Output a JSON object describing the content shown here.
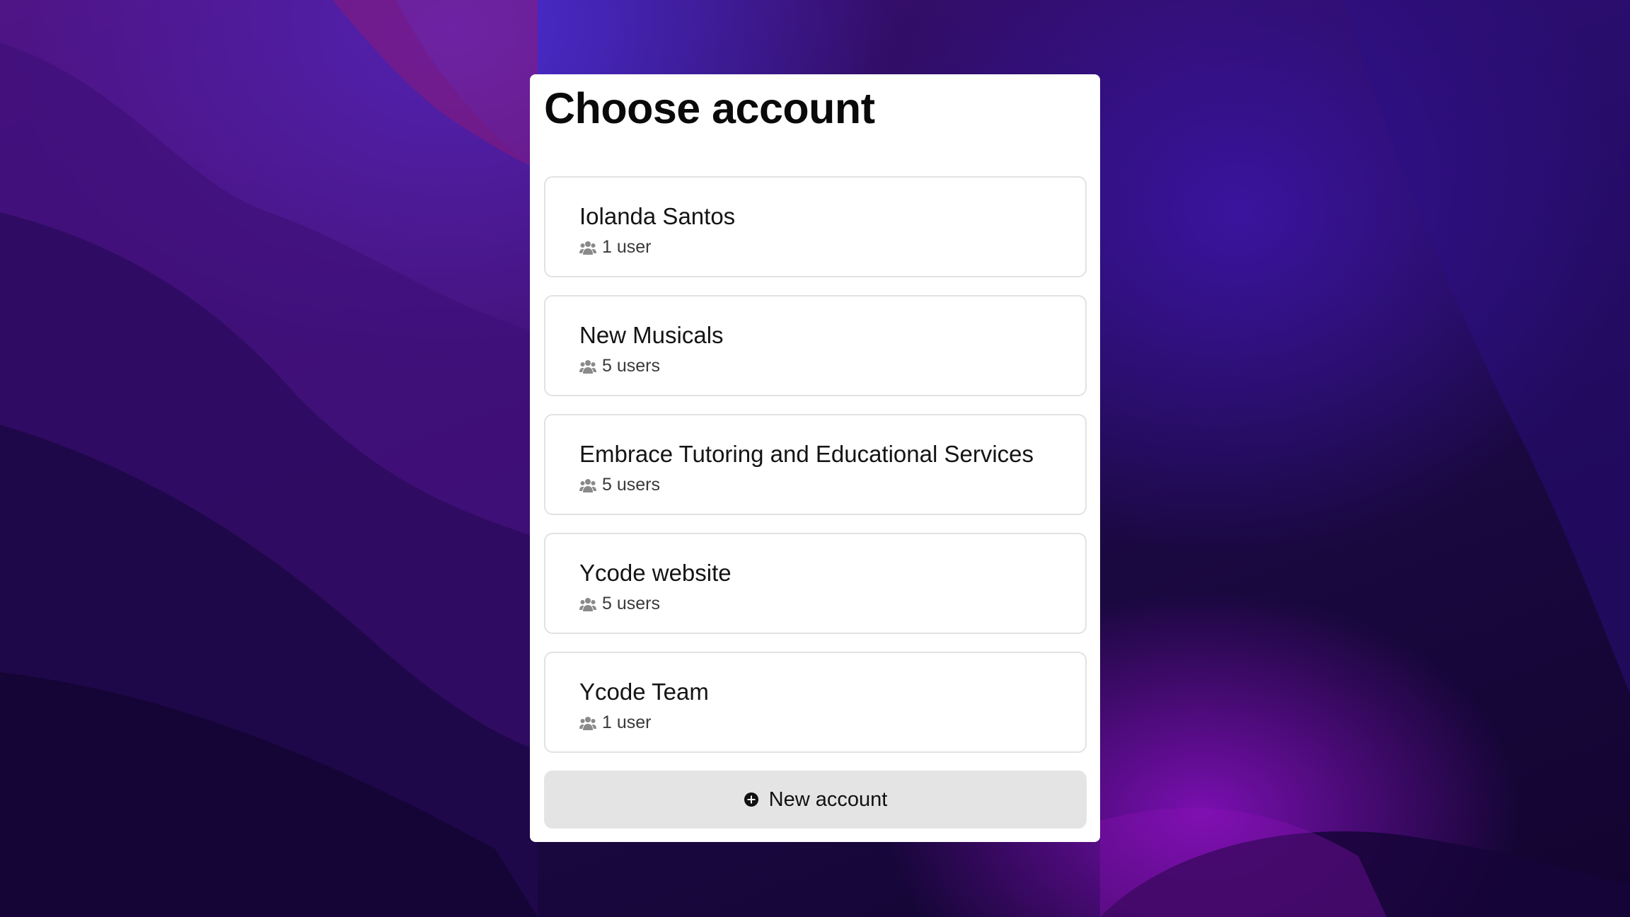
{
  "dialog": {
    "title": "Choose account"
  },
  "accounts": [
    {
      "name": "Iolanda Santos",
      "users": "1 user"
    },
    {
      "name": "New Musicals",
      "users": "5 users"
    },
    {
      "name": "Embrace Tutoring and Educational Services",
      "users": "5 users"
    },
    {
      "name": "Ycode website",
      "users": "5 users"
    },
    {
      "name": "Ycode Team",
      "users": "1 user"
    }
  ],
  "actions": {
    "new_account_label": "New account"
  },
  "icons": {
    "users": "users-icon",
    "add": "plus-circle-icon"
  },
  "colors": {
    "card_background": "#ffffff",
    "item_border": "#e2e2e2",
    "button_background": "#e4e4e4",
    "wallpaper_primary": "#2a0c5e",
    "wallpaper_accent": "#7a0fb0"
  }
}
